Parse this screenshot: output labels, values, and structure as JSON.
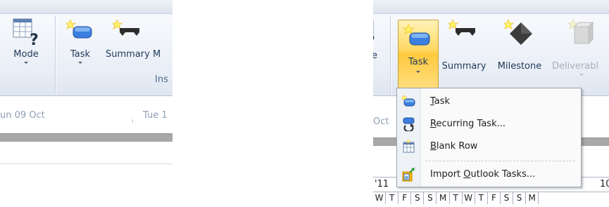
{
  "left_panel": {
    "buttons": {
      "mode": "Mode",
      "task": "Task",
      "summary": "Summary M"
    },
    "group_label": "Ins",
    "timeline_dates": [
      "un 09 Oct",
      "Tue 1"
    ]
  },
  "right_panel": {
    "buttons": {
      "mode": "e",
      "task": "Task",
      "summary": "Summary",
      "milestone": "Milestone",
      "deliverable": "Deliverabl"
    },
    "timeline_date": "Oct",
    "calendar_week": [
      "'11",
      "10"
    ],
    "calendar_days": [
      "W",
      "T",
      "F",
      "S",
      "S",
      "M",
      "T",
      "W",
      "T",
      "F",
      "S",
      "S",
      "M"
    ],
    "task_menu": {
      "items": [
        {
          "accel": "T",
          "rest": "ask",
          "icon": "task-icon"
        },
        {
          "accel": "R",
          "rest": "ecurring Task...",
          "icon": "recurring-task-icon"
        },
        {
          "accel": "B",
          "rest": "lank Row",
          "icon": "blank-row-icon"
        },
        {
          "pre": "Import ",
          "accel": "O",
          "rest": "utlook Tasks...",
          "icon": "import-outlook-icon"
        }
      ]
    }
  },
  "colors": {
    "ribbon_text": "#1e395b",
    "active_button": "#ffd760",
    "menu_bg": "#fafafa"
  }
}
